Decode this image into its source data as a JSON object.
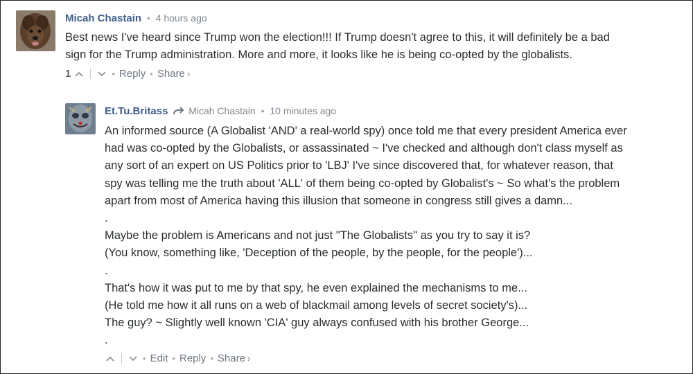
{
  "comments": [
    {
      "author": "Micah Chastain",
      "time": "4 hours ago",
      "avatar_icon": "dog-avatar-icon",
      "lines": [
        "Best news I've heard since Trump won the election!!! If Trump doesn't agree to this, it will definitely be a bad",
        "sign for the Trump administration. More and more, it looks like he is being co-opted by the globalists."
      ],
      "footer": {
        "vote_count": "1",
        "reply": "Reply",
        "share": "Share",
        "share_chevron": "›"
      }
    },
    {
      "author": "Et.Tu.Britass",
      "in_reply_to": "Micah Chastain",
      "time": "10 minutes ago",
      "avatar_icon": "mask-avatar-icon",
      "lines": [
        "An informed source (A Globalist 'AND' a real-world spy) once told me that every president America ever",
        "had was co-opted by the Globalists, or assassinated ~ I've checked and although don't class myself as",
        "any sort of an expert on US Politics prior to 'LBJ' I've since discovered that, for whatever reason, that",
        "spy was telling me the truth about 'ALL' of them being co-opted by Globalist's ~ So what's the problem",
        "apart from most of America having this illusion that someone in congress still gives a damn...",
        ".",
        "Maybe the problem is Americans and not just \"The Globalists\" as you try to say it is?",
        "(You know, something like, 'Deception of the people, by the people, for the people')...",
        ".",
        "That's how it was put to me by that spy, he even explained the mechanisms to me...",
        "(He told me how it all runs on a web of blackmail among levels of secret society's)...",
        "The guy? ~ Slightly well known 'CIA' guy always confused with his brother George...",
        "."
      ],
      "footer": {
        "edit": "Edit",
        "reply": "Reply",
        "share": "Share",
        "share_chevron": "›"
      }
    }
  ],
  "separator_dot": "•",
  "colors": {
    "author": "#3f5d8a",
    "meta": "#7f8790",
    "text": "#2a2e2e"
  }
}
